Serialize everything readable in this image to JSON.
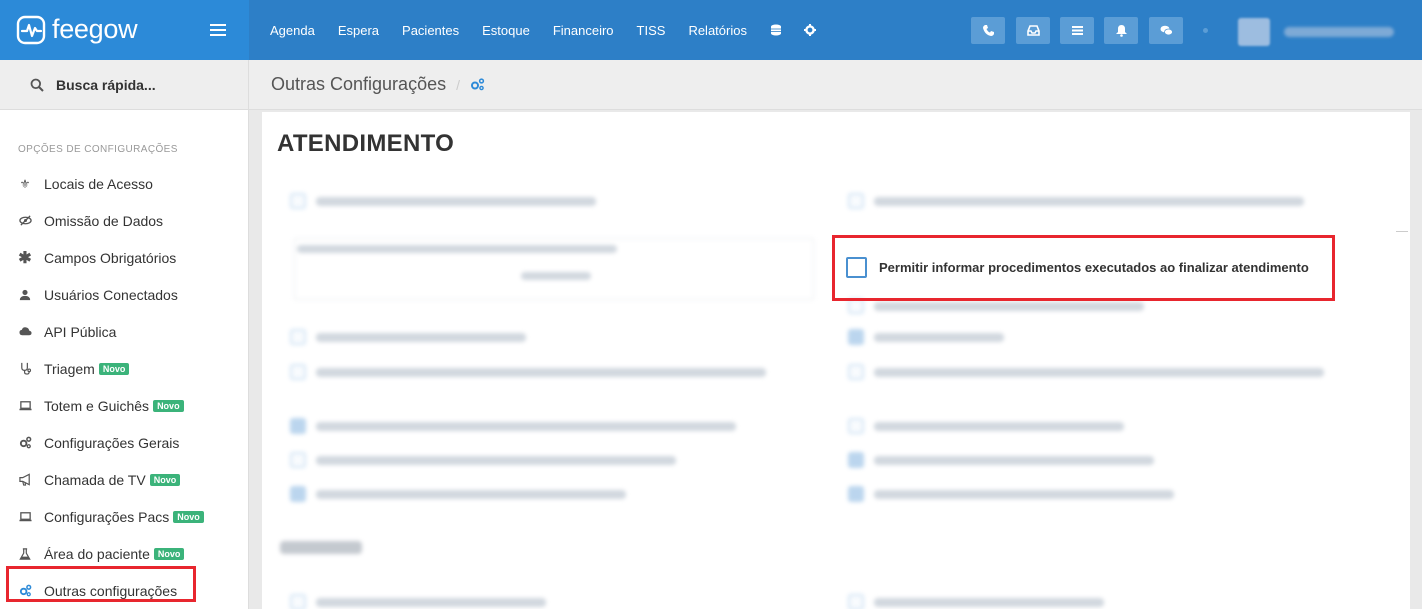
{
  "brand": {
    "name": "feegow"
  },
  "nav": {
    "items": [
      "Agenda",
      "Espera",
      "Pacientes",
      "Estoque",
      "Financeiro",
      "TISS",
      "Relatórios"
    ],
    "icons": [
      "database-icon",
      "gear-icon"
    ]
  },
  "toolbar": {
    "buttons": [
      "phone-icon",
      "inbox-icon",
      "list-icon",
      "bell-icon",
      "chat-icon"
    ]
  },
  "search": {
    "placeholder": "Busca rápida..."
  },
  "sidebar": {
    "header": "OPÇÕES DE CONFIGURAÇÕES",
    "badge_label": "Novo",
    "items": [
      {
        "label": "Locais de Acesso",
        "icon": "location-icon",
        "badge": false
      },
      {
        "label": "Omissão de Dados",
        "icon": "eye-slash-icon",
        "badge": false
      },
      {
        "label": "Campos Obrigatórios",
        "icon": "asterisk-icon",
        "badge": false
      },
      {
        "label": "Usuários Conectados",
        "icon": "user-icon",
        "badge": false
      },
      {
        "label": "API Pública",
        "icon": "cloud-icon",
        "badge": false
      },
      {
        "label": "Triagem",
        "icon": "stethoscope-icon",
        "badge": true
      },
      {
        "label": "Totem e Guichês",
        "icon": "laptop-icon",
        "badge": true
      },
      {
        "label": "Configurações Gerais",
        "icon": "cogs-icon",
        "badge": false
      },
      {
        "label": "Chamada de TV",
        "icon": "bullhorn-icon",
        "badge": true
      },
      {
        "label": "Configurações Pacs",
        "icon": "laptop-icon",
        "badge": true
      },
      {
        "label": "Área do paciente",
        "icon": "flask-icon",
        "badge": true
      },
      {
        "label": "Outras configurações",
        "icon": "cogs-icon",
        "badge": false
      }
    ]
  },
  "breadcrumb": {
    "title": "Outras Configurações",
    "separator": "/"
  },
  "content": {
    "section_title": "ATENDIMENTO",
    "highlighted_option": {
      "label": "Permitir informar procedimentos executados ao finalizar atendimento",
      "checked": false
    }
  },
  "colors": {
    "topbar": "#2d7fc7",
    "brand": "#2c8ad8",
    "highlight": "#e8262e",
    "badge": "#3bb37a"
  }
}
